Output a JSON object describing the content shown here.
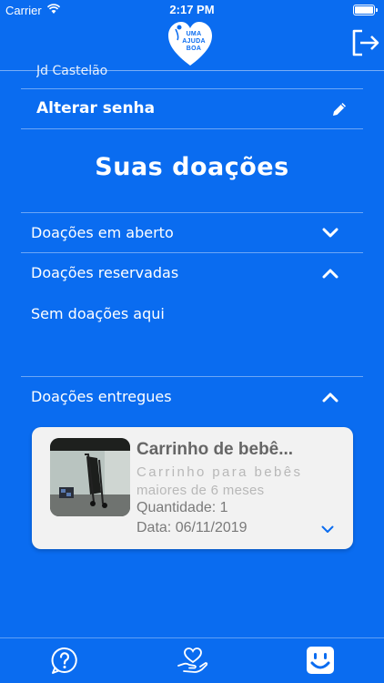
{
  "status_bar": {
    "carrier": "Carrier",
    "time": "2:17 PM"
  },
  "header": {
    "logo_text": [
      "UMA",
      "AJUDA",
      "BOA"
    ]
  },
  "profile": {
    "address_partial": "Jd Castelão",
    "change_password_label": "Alterar senha"
  },
  "donations": {
    "title": "Suas doações",
    "sections": [
      {
        "label": "Doações em aberto",
        "expanded": false
      },
      {
        "label": "Doações reservadas",
        "expanded": true,
        "empty_message": "Sem doações aqui"
      },
      {
        "label": "Doações entregues",
        "expanded": true
      }
    ],
    "delivered_items": [
      {
        "title": "Carrinho de bebê...",
        "description_line1": "Carrinho para bebês",
        "description_line2": "maiores de 6 meses",
        "quantity": "Quantidade: 1",
        "date": "Data: 06/11/2019"
      }
    ]
  },
  "tab_bar": {
    "icons": [
      "help-icon",
      "donate-heart-hand-icon",
      "profile-smiley-icon"
    ],
    "active": "profile-smiley-icon"
  },
  "colors": {
    "background": "#0A6CF0",
    "card": "#f2f2f2",
    "accent": "#0A6CF0"
  }
}
